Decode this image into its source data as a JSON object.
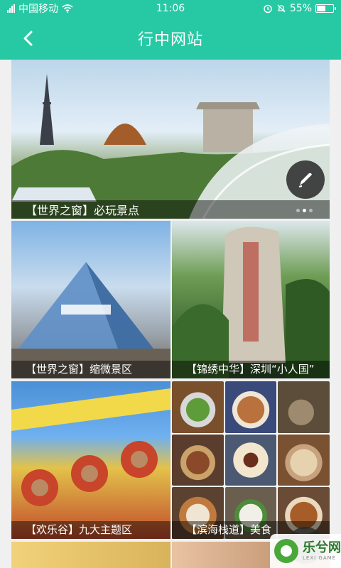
{
  "status_bar": {
    "carrier": "中国移动",
    "time": "11:06",
    "battery_text": "55%",
    "battery_level": 0.55,
    "icons": [
      "signal-icon",
      "wifi-icon",
      "alarm-icon",
      "silent-icon",
      "battery-icon"
    ]
  },
  "nav": {
    "title": "行中网站",
    "back_icon": "back-arrow-icon"
  },
  "banner": {
    "caption": "【世界之窗】必玩景点",
    "page_count": 3,
    "active_page": 1,
    "edit_icon": "pen-icon"
  },
  "tiles": [
    {
      "caption": "【世界之窗】缩微景区"
    },
    {
      "caption": "【锦绣中华】深圳“小人国”"
    },
    {
      "caption": "【欢乐谷】九大主题区"
    },
    {
      "caption": "【滨海栈道】美食"
    }
  ],
  "watermark": {
    "name": "乐兮网",
    "sub": "LEXI GAME"
  },
  "colors": {
    "accent": "#27c9a4",
    "caption_bg": "rgba(0,0,0,0.45)"
  }
}
